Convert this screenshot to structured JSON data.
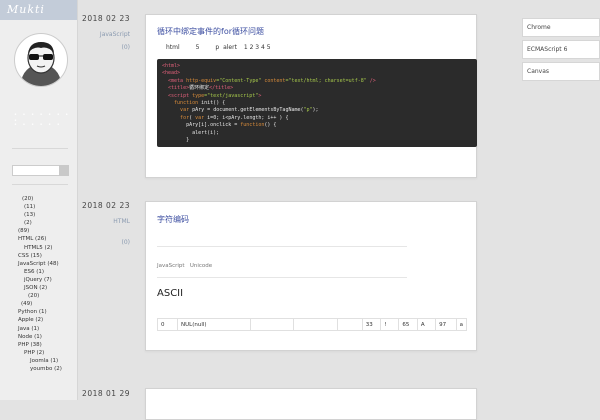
{
  "sidebar": {
    "logo": "Mukti",
    "tags": [
      {
        "label": "(20)",
        "indent": 22
      },
      {
        "label": "(11)",
        "indent": 24
      },
      {
        "label": "(13)",
        "indent": 24
      },
      {
        "label": "(2)",
        "indent": 24
      },
      {
        "label": "(89)",
        "indent": 18
      },
      {
        "label": "HTML (26)",
        "indent": 18
      },
      {
        "label": "HTML5 (2)",
        "indent": 24
      },
      {
        "label": "CSS (15)",
        "indent": 18
      },
      {
        "label": "JavaScript (48)",
        "indent": 18
      },
      {
        "label": "ES6 (1)",
        "indent": 24
      },
      {
        "label": "jQuery (7)",
        "indent": 24
      },
      {
        "label": "JSON (2)",
        "indent": 24
      },
      {
        "label": "(20)",
        "indent": 28
      },
      {
        "label": "(49)",
        "indent": 21
      },
      {
        "label": "Python (1)",
        "indent": 18
      },
      {
        "label": "Apple (2)",
        "indent": 18
      },
      {
        "label": "Java (1)",
        "indent": 18
      },
      {
        "label": "Node (1)",
        "indent": 18
      },
      {
        "label": "PHP (38)",
        "indent": 18
      },
      {
        "label": "PHP (2)",
        "indent": 24
      },
      {
        "label": "Joomla (1)",
        "indent": 30
      },
      {
        "label": "youmbo (2)",
        "indent": 30
      }
    ]
  },
  "posts": [
    {
      "date": "2018 02 23",
      "category": "JavaScript",
      "comments": "(0)",
      "title": "循环中绑定事件的for循环问题",
      "intro": "html 5 p alert 1 2 3 4 5"
    },
    {
      "date": "2018 02 23",
      "category": "HTML",
      "comments": "(0)",
      "title": "字符编码",
      "tags": "JavaScript   Unicode",
      "heading": "ASCII"
    },
    {
      "date": "2018 01 29"
    }
  ],
  "intro_words": [
    "html",
    "5",
    "p",
    "alert",
    "1 2 3 4 5"
  ],
  "code_lines": [
    [
      [
        "<html>",
        "#e0607a"
      ]
    ],
    [
      [
        "<head>",
        "#e0607a"
      ]
    ],
    [
      [
        "  <meta ",
        "#e0607a"
      ],
      [
        "http-equiv",
        "#d98c3a"
      ],
      [
        "=\"Content-Type\" ",
        "#a6c84b"
      ],
      [
        "content",
        "#d98c3a"
      ],
      [
        "=\"text/html; charset=utf-8\"",
        "#a6c84b"
      ],
      [
        " />",
        "#e0607a"
      ]
    ],
    [
      [
        "  <title>",
        "#e0607a"
      ],
      [
        "循环绑定",
        "#e6e6e6"
      ],
      [
        "</title>",
        "#e0607a"
      ]
    ],
    [
      [
        "  <script ",
        "#e0607a"
      ],
      [
        "type",
        "#d98c3a"
      ],
      [
        "=\"text/javascript\"",
        "#a6c84b"
      ],
      [
        ">",
        "#e0607a"
      ]
    ],
    [
      [
        "    function ",
        "#d98c3a"
      ],
      [
        "init() {",
        "#e6e6e6"
      ]
    ],
    [
      [
        "      var ",
        "#d98c3a"
      ],
      [
        "pAry = ",
        "#e6e6e6"
      ],
      [
        "document",
        "#e6e6e6"
      ],
      [
        ".getElementsByTagName(",
        "#e6e6e6"
      ],
      [
        "\"p\"",
        "#a6c84b"
      ],
      [
        ");",
        "#e6e6e6"
      ]
    ],
    [
      [
        "      for",
        "#d98c3a"
      ],
      [
        "( ",
        "#e6e6e6"
      ],
      [
        "var ",
        "#d98c3a"
      ],
      [
        "i=0; i<pAry.length; i++ ) {",
        "#e6e6e6"
      ]
    ],
    [
      [
        "        pAry[i].onclick = ",
        "#e6e6e6"
      ],
      [
        "function",
        "#d98c3a"
      ],
      [
        "() {",
        "#e6e6e6"
      ]
    ],
    [
      [
        "          alert(i);",
        "#e6e6e6"
      ]
    ],
    [
      [
        "        }",
        "#e6e6e6"
      ]
    ]
  ],
  "ascii_row": [
    "0",
    "NUL(null)",
    "",
    "",
    "",
    "33",
    "!",
    "65",
    "A",
    "97",
    "a"
  ],
  "right_tags": [
    "Chrome",
    "ECMAScript 6",
    "Canvas"
  ]
}
